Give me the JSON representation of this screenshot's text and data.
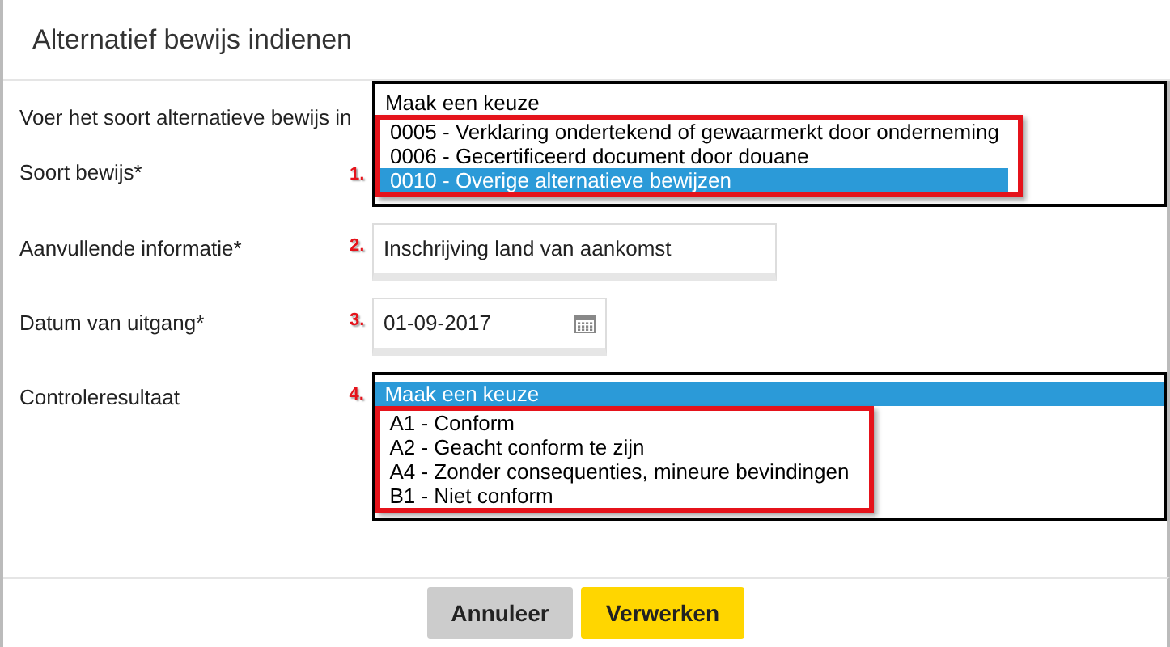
{
  "dialog": {
    "title": "Alternatief bewijs indienen",
    "fields": [
      {
        "kind": "listbox",
        "labels": [
          "Voer het soort alternatieve bewijs in",
          "Soort bewijs*"
        ],
        "marker": "1.",
        "options": [
          {
            "label": "Maak een keuze",
            "selected": false,
            "boxed": false
          },
          {
            "label": "0005 - Verklaring ondertekend of gewaarmerkt door onderneming",
            "selected": false,
            "boxed": true
          },
          {
            "label": "0006 - Gecertificeerd document door douane",
            "selected": false,
            "boxed": true
          },
          {
            "label": "0010 - Overige alternatieve bewijzen",
            "selected": true,
            "boxed": true
          }
        ]
      },
      {
        "kind": "text",
        "labels": [
          "Aanvullende informatie*"
        ],
        "marker": "2.",
        "value": "Inschrijving land van aankomst"
      },
      {
        "kind": "date",
        "labels": [
          "Datum van uitgang*"
        ],
        "marker": "3.",
        "value": "01-09-2017"
      },
      {
        "kind": "listbox",
        "labels": [
          "Controleresultaat"
        ],
        "marker": "4.",
        "options": [
          {
            "label": "Maak een keuze",
            "selected": true,
            "boxed": false
          },
          {
            "label": "A1 - Conform",
            "selected": false,
            "boxed": true
          },
          {
            "label": "A2 - Geacht conform te zijn",
            "selected": false,
            "boxed": true
          },
          {
            "label": "A4 - Zonder consequenties, mineure bevindingen",
            "selected": false,
            "boxed": true
          },
          {
            "label": "B1 - Niet conform",
            "selected": false,
            "boxed": true
          }
        ]
      }
    ],
    "buttons": [
      {
        "label": "Annuleer",
        "kind": "secondary"
      },
      {
        "label": "Verwerken",
        "kind": "primary"
      }
    ]
  }
}
